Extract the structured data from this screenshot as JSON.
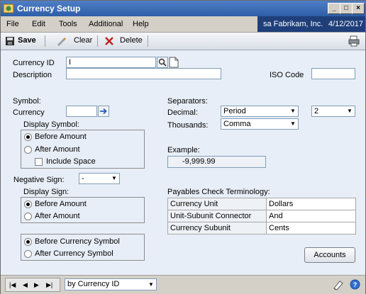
{
  "window": {
    "title": "Currency Setup",
    "controls": [
      "_",
      "□",
      "×"
    ]
  },
  "menubar": {
    "items": [
      "File",
      "Edit",
      "Tools",
      "Additional",
      "Help"
    ],
    "company": "sa  Fabrikam, Inc.",
    "date": "4/12/2017"
  },
  "toolbar": {
    "save": "Save",
    "clear": "Clear",
    "delete": "Delete"
  },
  "form": {
    "currency_id_label": "Currency ID",
    "currency_id_value": "I",
    "description_label": "Description",
    "description_value": "",
    "iso_label": "ISO Code",
    "iso_value": "",
    "symbol_label": "Symbol:",
    "currency_label": "Currency",
    "currency_value": "",
    "display_symbol_label": "Display Symbol:",
    "before_amount": "Before Amount",
    "after_amount": "After Amount",
    "include_space": "Include Space",
    "negative_sign_label": "Negative Sign:",
    "negative_sign_value": "-",
    "display_sign_label": "Display Sign:",
    "sign_before_amount": "Before Amount",
    "sign_after_amount": "After Amount",
    "before_currency_symbol": "Before Currency Symbol",
    "after_currency_symbol": "After Currency Symbol",
    "separators_label": "Separators:",
    "decimal_label": "Decimal:",
    "decimal_value": "Period",
    "decimal_places_value": "2",
    "thousands_label": "Thousands:",
    "thousands_value": "Comma",
    "example_label": "Example:",
    "example_value": "-9,999.99",
    "payables_label": "Payables Check Terminology:",
    "payables_rows": [
      {
        "label": "Currency Unit",
        "value": "Dollars"
      },
      {
        "label": "Unit-Subunit Connector",
        "value": "And"
      },
      {
        "label": "Currency Subunit",
        "value": "Cents"
      }
    ],
    "accounts_button": "Accounts"
  },
  "statusbar": {
    "sort_value": "by Currency ID"
  },
  "colors": {
    "title_bar": "#2d5ea8",
    "company_bar": "#1f3f7a",
    "form_background": "#e8eef7"
  }
}
